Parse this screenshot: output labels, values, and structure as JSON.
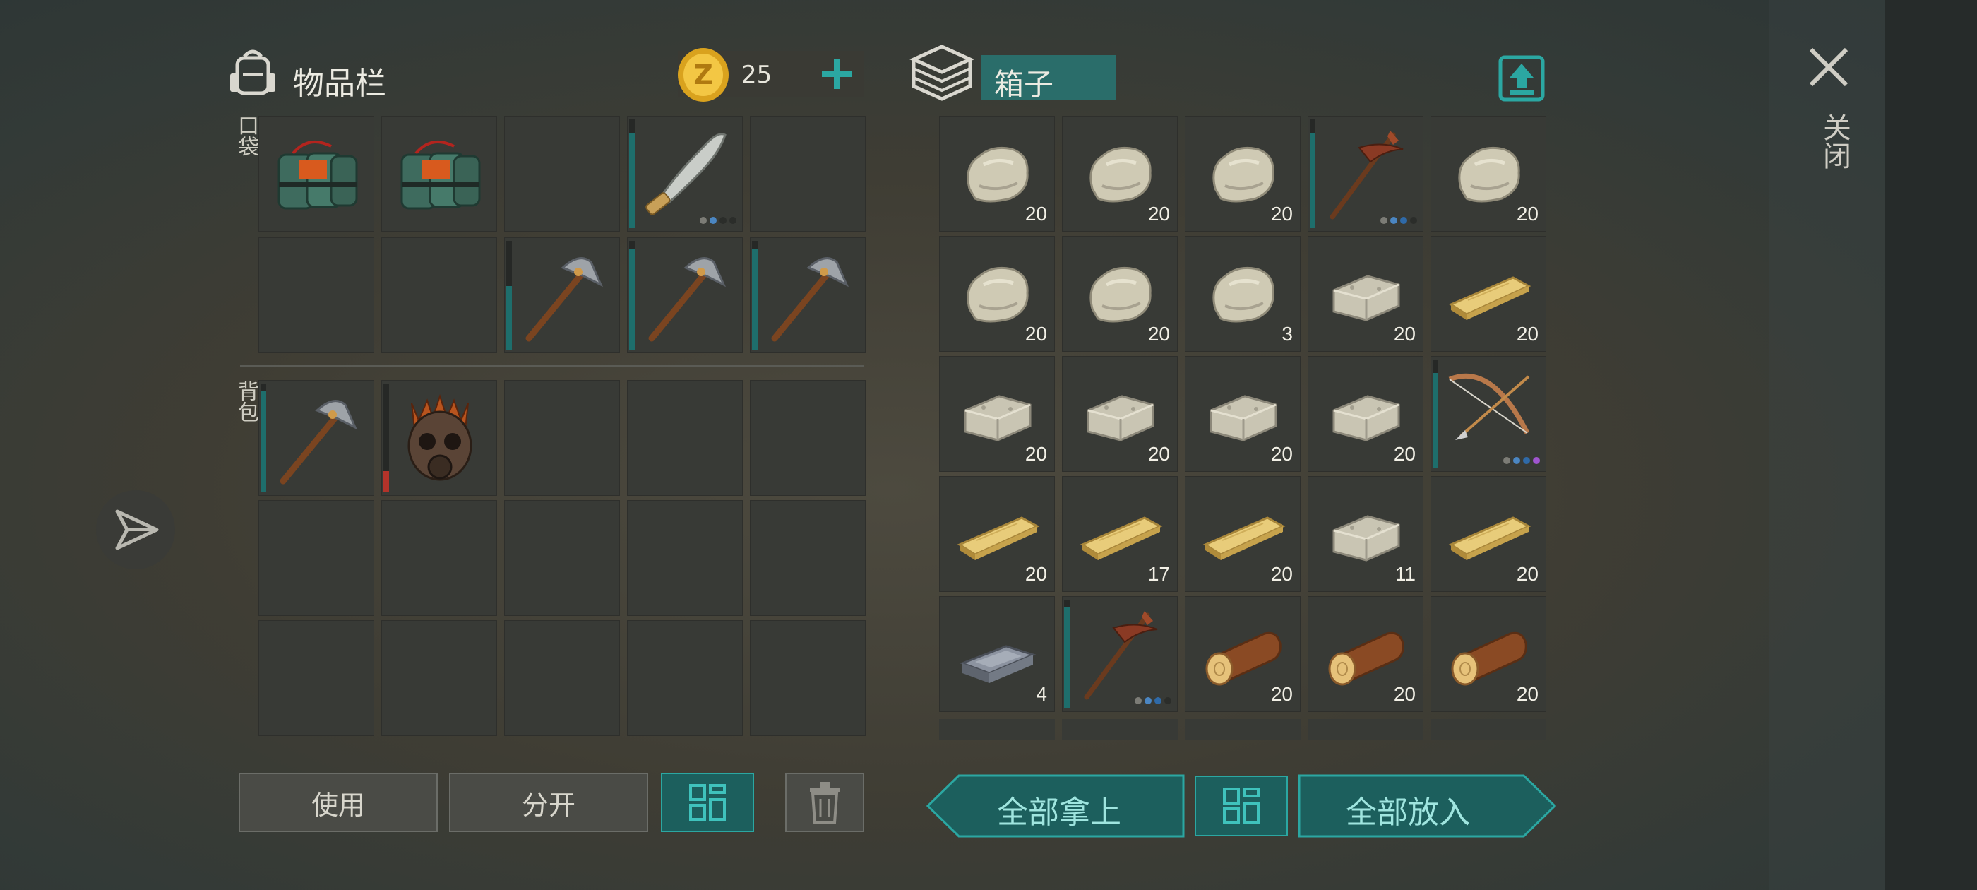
{
  "inventory": {
    "title": "物品栏",
    "coins": "25",
    "pocket_label": "口袋",
    "backpack_label": "背包"
  },
  "chest": {
    "title": "箱子"
  },
  "close_label": "关闭",
  "buttons": {
    "use": "使用",
    "split": "分开",
    "take_all": "全部拿上",
    "put_all": "全部放入"
  },
  "pocket_slots": [
    {
      "item": "explosive-pack-icon",
      "count": ""
    },
    {
      "item": "explosive-pack-icon",
      "count": ""
    },
    {
      "item": "",
      "count": ""
    },
    {
      "item": "machete-icon",
      "count": "",
      "durability": 0.9,
      "tier": 2
    },
    {
      "item": "",
      "count": ""
    },
    {
      "item": "",
      "count": ""
    },
    {
      "item": "",
      "count": ""
    },
    {
      "item": "hammer-icon",
      "count": "",
      "durability": 0.6
    },
    {
      "item": "hammer-icon",
      "count": "",
      "durability": 0.95
    },
    {
      "item": "hammer-icon",
      "count": "",
      "durability": 0.95
    }
  ],
  "backpack_slots": [
    {
      "item": "hammer-icon",
      "count": "",
      "durability": 0.95
    },
    {
      "item": "gas-mask-icon",
      "count": "",
      "durability": 0.2,
      "durability_color": "red"
    },
    {
      "item": "",
      "count": ""
    },
    {
      "item": "",
      "count": ""
    },
    {
      "item": "",
      "count": ""
    },
    {
      "item": "",
      "count": ""
    },
    {
      "item": "",
      "count": ""
    },
    {
      "item": "",
      "count": ""
    },
    {
      "item": "",
      "count": ""
    },
    {
      "item": "",
      "count": ""
    },
    {
      "item": "",
      "count": ""
    },
    {
      "item": "",
      "count": ""
    },
    {
      "item": "",
      "count": ""
    },
    {
      "item": "",
      "count": ""
    },
    {
      "item": "",
      "count": ""
    }
  ],
  "chest_slots": [
    {
      "item": "stone-icon",
      "count": "20"
    },
    {
      "item": "stone-icon",
      "count": "20"
    },
    {
      "item": "stone-icon",
      "count": "20"
    },
    {
      "item": "pickaxe-icon",
      "count": "",
      "durability": 0.9,
      "tier": 3
    },
    {
      "item": "stone-icon",
      "count": "20"
    },
    {
      "item": "stone-icon",
      "count": "20"
    },
    {
      "item": "stone-icon",
      "count": "20"
    },
    {
      "item": "stone-icon",
      "count": "3"
    },
    {
      "item": "limestone-icon",
      "count": "20"
    },
    {
      "item": "plank-icon",
      "count": "20"
    },
    {
      "item": "limestone-icon",
      "count": "20"
    },
    {
      "item": "limestone-icon",
      "count": "20"
    },
    {
      "item": "limestone-icon",
      "count": "20"
    },
    {
      "item": "limestone-icon",
      "count": "20"
    },
    {
      "item": "bow-icon",
      "count": "",
      "durability": 0.9,
      "tier": 4
    },
    {
      "item": "plank-icon",
      "count": "20"
    },
    {
      "item": "plank-icon",
      "count": "17"
    },
    {
      "item": "plank-icon",
      "count": "20"
    },
    {
      "item": "limestone-icon",
      "count": "11"
    },
    {
      "item": "plank-icon",
      "count": "20"
    },
    {
      "item": "iron-ingot-icon",
      "count": "4"
    },
    {
      "item": "pickaxe-icon",
      "count": "",
      "durability": 0.95,
      "tier": 3
    },
    {
      "item": "log-icon",
      "count": "20"
    },
    {
      "item": "log-icon",
      "count": "20"
    },
    {
      "item": "log-icon",
      "count": "20"
    }
  ],
  "colors": {
    "accent": "#2ba7a2",
    "slot": "#383a36",
    "durability": "#1e6e6c"
  }
}
